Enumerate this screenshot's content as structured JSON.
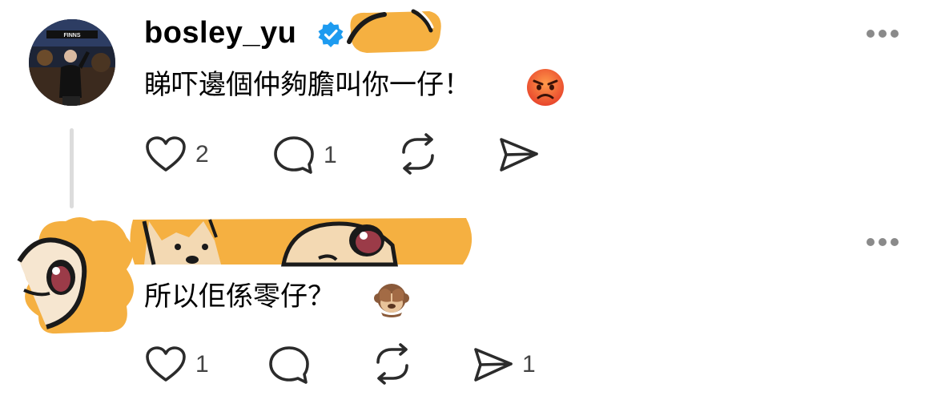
{
  "posts": [
    {
      "username": "bosley_yu",
      "text": "睇吓邊個仲夠膽叫你一仔！",
      "emoji": "angry-face",
      "actions": {
        "likes": "2",
        "replies": "1",
        "reposts": "",
        "shares": ""
      }
    },
    {
      "username": "",
      "text": "所以佢係零仔？",
      "emoji": "see-no-evil-monkey",
      "actions": {
        "likes": "1",
        "replies": "",
        "reposts": "",
        "shares": "1"
      }
    }
  ],
  "colors": {
    "verified_badge": "#1d9bf0",
    "censor_sticker": "#f5b041",
    "icon_stroke": "#2b2b2b",
    "more_dots": "#8a8a8a",
    "thread_line": "#dcdcdc"
  },
  "icons": [
    "heart-icon",
    "comment-icon",
    "repost-icon",
    "share-icon",
    "more-icon",
    "verified-badge-icon"
  ]
}
